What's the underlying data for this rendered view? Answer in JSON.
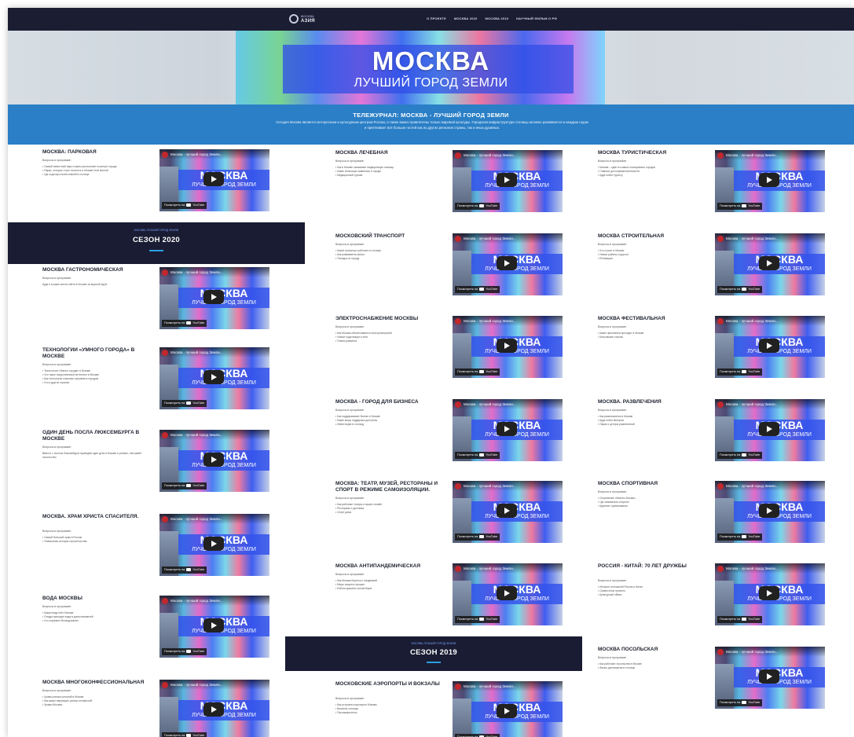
{
  "nav": {
    "logo_text": "АЗИЯ",
    "logo_sub": "МОСКВА",
    "links": [
      "О ПРОЕКТЕ",
      "МОСКВА 2020",
      "МОСКВА 2019",
      "НАУЧНЫЙ ФИЛЬМ О РФ"
    ]
  },
  "hero": {
    "title": "МОСКВА",
    "subtitle": "ЛУЧШИЙ ГОРОД ЗЕМЛИ"
  },
  "intro": {
    "title": "ТЕЛЕЖУРНАЛ: МОСКВА - ЛУЧШИЙ ГОРОД ЗЕМЛИ",
    "text": "Сегодня Москва является интересным и культурным центром России, а также важно привлечены только мировой культуры. Городская инфраструктура столицы активно развивается и каждым годом и притягивает всё больше гостей как из других регионов страны, так и иных душевых."
  },
  "video": {
    "channel_title": "Москва - лучший город Земли...",
    "big1": "МОСКВА",
    "big2": "ЛУЧШИЙ ГОРОД ЗЕМЛИ",
    "watch_label": "Посмотреть на",
    "yt_label": "YouTube"
  },
  "meta_label": "Вопросы в программе:",
  "seasons": [
    {
      "small": "МОСКВА ЛУЧШИЙ ГОРОД ЗЕМЛИ",
      "title": "СЕЗОН 2020"
    },
    {
      "small": "МОСКВА ЛУЧШИЙ ГОРОД ЗЕМЛИ",
      "title": "СЕЗОН 2019"
    }
  ],
  "col1": [
    {
      "title": "МОСКВА: ПАРКОВАЯ",
      "text": "• Самый известный парк страны расположен в центре города\n• Парки, которые стоит посетить в Москве этой весной\n• Где отдохнуть всей семьёй в столице"
    },
    {
      "title": "МОСКВА ГАСТРОНОМИЧЕСКАЯ",
      "text": "Куда и в какие места пойти в Москве за вкусной едой."
    },
    {
      "title": "ТЕХНОЛОГИИ «УМНОГО ГОРОДА» В МОСКВЕ",
      "text": "• Технологии «Умного города» в Москве\n• Что такое искусственный интеллект в Москве\n• Как технологии помогают управлять городом\n• Что в других странах"
    },
    {
      "title": "ОДИН ДЕНЬ ПОСЛА ЛЮКСЕМБУРГА В МОСКВЕ",
      "text": "Вместе с послом Люксембурга проведём один день в Москве и узнаем, чем живёт посольство."
    },
    {
      "title": "МОСКВА. ХРАМ ХРИСТА СПАСИТЕЛЯ.",
      "text": "• Самый большой храм в России\n• Уникальная история строительства"
    },
    {
      "title": "ВОДА МОСКВЫ",
      "text": "• Какую воду пьёт Москва\n• Откуда приходит вода в дома москвичей\n• Что охраняет Мосводоканал"
    },
    {
      "title": "МОСКВА МНОГОКОНФЕССИОНАЛЬНАЯ",
      "text": "• Храмы разных религий в Москве\n• Как живут верующие разных конфессий\n• Храмы Москвы"
    }
  ],
  "col2": [
    {
      "title": "МОСКВА ЛЕЧЕБНАЯ",
      "text": "• Как в Москве оказывают медицинскую помощь\n• Какие больницы появились в городе\n• Медицинский туризм"
    },
    {
      "title": "МОСКОВСКИЙ ТРАНСПОРТ",
      "text": "• Какой транспорт работает в столице\n• Как развивается метро\n• Поездки по городу"
    },
    {
      "title": "ЭЛЕКТРОСНАБЖЕНИЕ МОСКВЫ",
      "text": "• Как Москва обеспечивается электроэнергией\n• Новые подстанции и сети\n• Планы развития"
    },
    {
      "title": "МОСКВА - ГОРОД ДЛЯ БИЗНЕСА",
      "text": "• Как поддерживают бизнес в Москве\n• Какие меры поддержки доступны\n• Инвестиции в столицу"
    },
    {
      "title": "МОСКВА: ТЕАТР, МУЗЕЙ, РЕСТОРАНЫ И СПОРТ В РЕЖИМЕ САМОИЗОЛЯЦИИ.",
      "text": "• Как работают театры и музеи онлайн\n• Рестораны и доставка\n• Спорт дома"
    },
    {
      "title": "МОСКВА АНТИПАНДЕМИЧЕСКАЯ",
      "text": "• Как Москва борется с пандемией\n• Меры защиты горожан\n• Работа врачей и волонтёров"
    },
    {
      "title": "МОСКОВСКИЕ АЭРОПОРТЫ И ВОКЗАЛЫ",
      "text": "• Как устроены аэропорты Москвы\n• Вокзалы столицы\n• Пассажиропоток"
    }
  ],
  "col3": [
    {
      "title": "МОСКВА ТУРИСТИЧЕСКАЯ",
      "text": "• Москва – один из самых посещаемых городов\n• Главные достопримечательности\n• Куда пойти туристу"
    },
    {
      "title": "МОСКВА СТРОИТЕЛЬНАЯ",
      "text": "• Что строят в Москве\n• Новые районы и дороги\n• Реновация"
    },
    {
      "title": "МОСКВА ФЕСТИВАЛЬНАЯ",
      "text": "• Какие фестивали проходят в Москве\n• Московские сезоны"
    },
    {
      "title": "МОСКВА. РАЗВЛЕЧЕНИЯ",
      "text": "• Как развлекаются в Москве\n• Куда пойти вечером\n• Парки и центры развлечений"
    },
    {
      "title": "МОСКВА СПОРТИВНАЯ",
      "text": "• Спортивные объекты Москвы\n• Где заниматься спортом\n• Крупные соревнования"
    },
    {
      "title": "РОССИЯ - КИТАЙ: 70 ЛЕТ ДРУЖБЫ",
      "text": "• История отношений России и Китая\n• Совместные проекты\n• Культурный обмен"
    },
    {
      "title": "МОСКВА ПОСОЛЬСКАЯ",
      "text": "• Как работают посольства в Москве\n• Жизнь дипломатов в столице"
    }
  ]
}
